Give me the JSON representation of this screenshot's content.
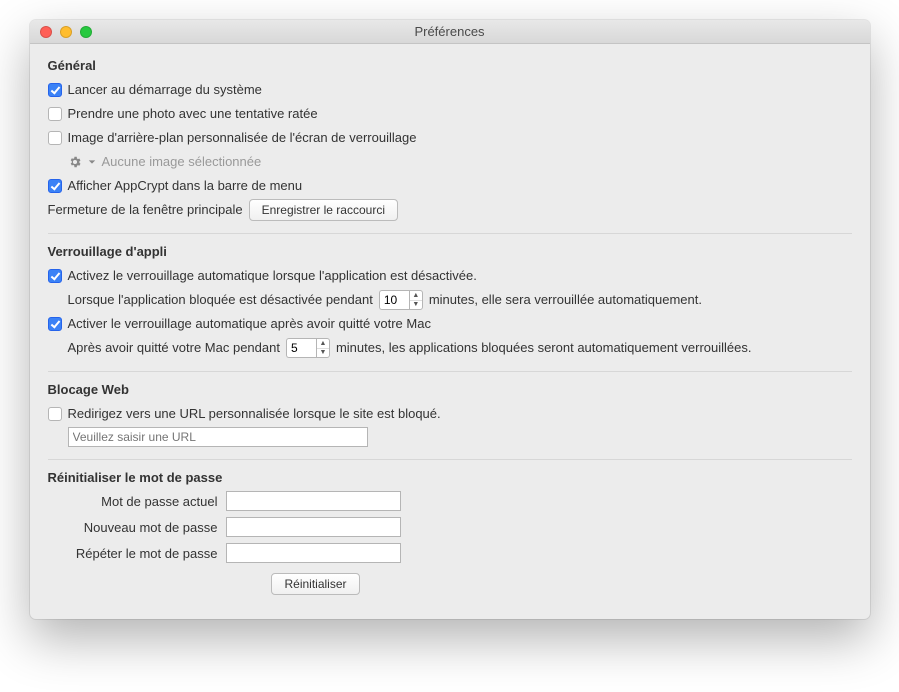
{
  "window": {
    "title": "Préférences"
  },
  "general": {
    "heading": "Général",
    "launch_at_startup": {
      "label": "Lancer au démarrage du système",
      "checked": true
    },
    "take_photo": {
      "label": "Prendre une photo avec une tentative ratée",
      "checked": false
    },
    "custom_bg": {
      "label": "Image d'arrière-plan personnalisée de l'écran de verrouillage",
      "checked": false
    },
    "custom_bg_none": "Aucune image sélectionnée",
    "show_menu": {
      "label": "Afficher AppCrypt dans la barre de menu",
      "checked": true
    },
    "close_main_label": "Fermeture de la fenêtre principale",
    "record_shortcut_btn": "Enregistrer le raccourci"
  },
  "applock": {
    "heading": "Verrouillage d'appli",
    "auto_when_idle": {
      "label": "Activez le verrouillage automatique lorsque l'application est désactivée.",
      "checked": true
    },
    "idle_sentence_pre": "Lorsque l'application bloquée est désactivée pendant",
    "idle_value": "10",
    "idle_sentence_post": "minutes, elle sera verrouillée automatiquement.",
    "auto_after_leave": {
      "label": "Activer le verrouillage automatique après avoir quitté votre Mac",
      "checked": true
    },
    "leave_sentence_pre": "Après avoir quitté votre Mac pendant",
    "leave_value": "5",
    "leave_sentence_post": "minutes, les applications bloquées seront automatiquement verrouillées."
  },
  "webblock": {
    "heading": "Blocage Web",
    "redirect": {
      "label": "Redirigez vers une URL personnalisée lorsque le site est bloqué.",
      "checked": false
    },
    "url_placeholder": "Veuillez saisir une URL",
    "url_value": ""
  },
  "resetpw": {
    "heading": "Réinitialiser le mot de passe",
    "current_label": "Mot de passe actuel",
    "new_label": "Nouveau mot de passe",
    "repeat_label": "Répéter le mot de passe",
    "reset_btn": "Réinitialiser"
  }
}
